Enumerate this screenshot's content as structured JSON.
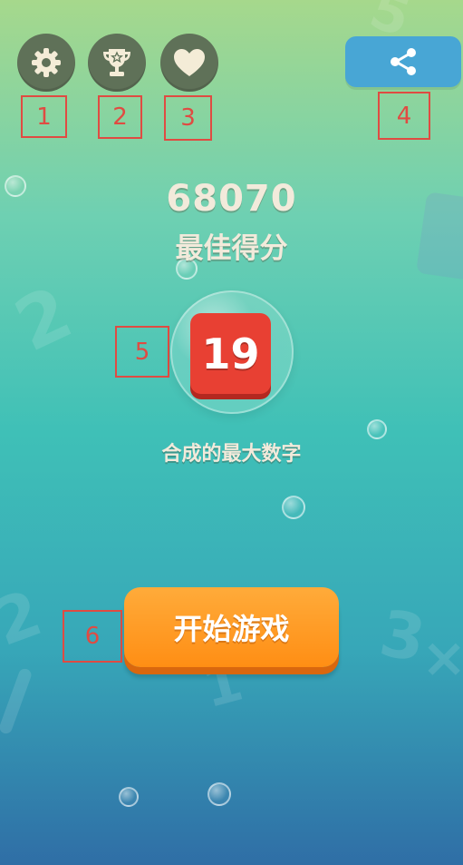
{
  "toolbar": {
    "settings": {
      "icon": "gear-icon"
    },
    "leaderboard": {
      "icon": "trophy-icon"
    },
    "like": {
      "icon": "heart-icon"
    },
    "share": {
      "icon": "share-icon",
      "color": "#48a6d5"
    }
  },
  "markers": [
    "1",
    "2",
    "3",
    "4",
    "5",
    "6"
  ],
  "best_score": {
    "value": "68070",
    "label": "最佳得分"
  },
  "max_number": {
    "value": "19",
    "label": "合成的最大数字",
    "tile_color": "#e84033"
  },
  "start_button": {
    "label": "开始游戏",
    "color": "#ff9a1f"
  },
  "colors": {
    "icon_button": "#5f7158",
    "text": "#f2eadb",
    "marker": "#e04b42"
  }
}
